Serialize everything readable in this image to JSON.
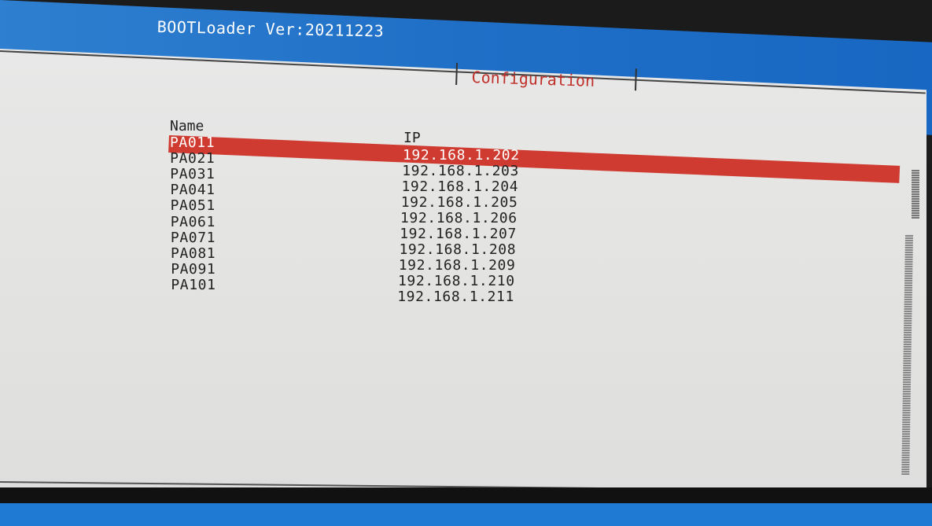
{
  "header": {
    "title": "BOOTLoader Ver:20211223"
  },
  "dialog": {
    "title": "Configuration"
  },
  "table": {
    "columns": {
      "name": "Name",
      "ip": "IP"
    },
    "names": [
      "PA011",
      "PA021",
      "PA031",
      "PA041",
      "PA051",
      "PA061",
      "PA071",
      "PA081",
      "PA091",
      "PA101"
    ],
    "ips": [
      "192.168.1.202",
      "192.168.1.203",
      "192.168.1.204",
      "192.168.1.205",
      "192.168.1.206",
      "192.168.1.207",
      "192.168.1.208",
      "192.168.1.209",
      "192.168.1.210",
      "192.168.1.211"
    ],
    "selected_index": 0
  },
  "colors": {
    "header_bg": "#1f6fc7",
    "panel_bg": "#e6e6e4",
    "selection": "#cf3b30",
    "dialog_title": "#c0302a",
    "text": "#222222"
  }
}
